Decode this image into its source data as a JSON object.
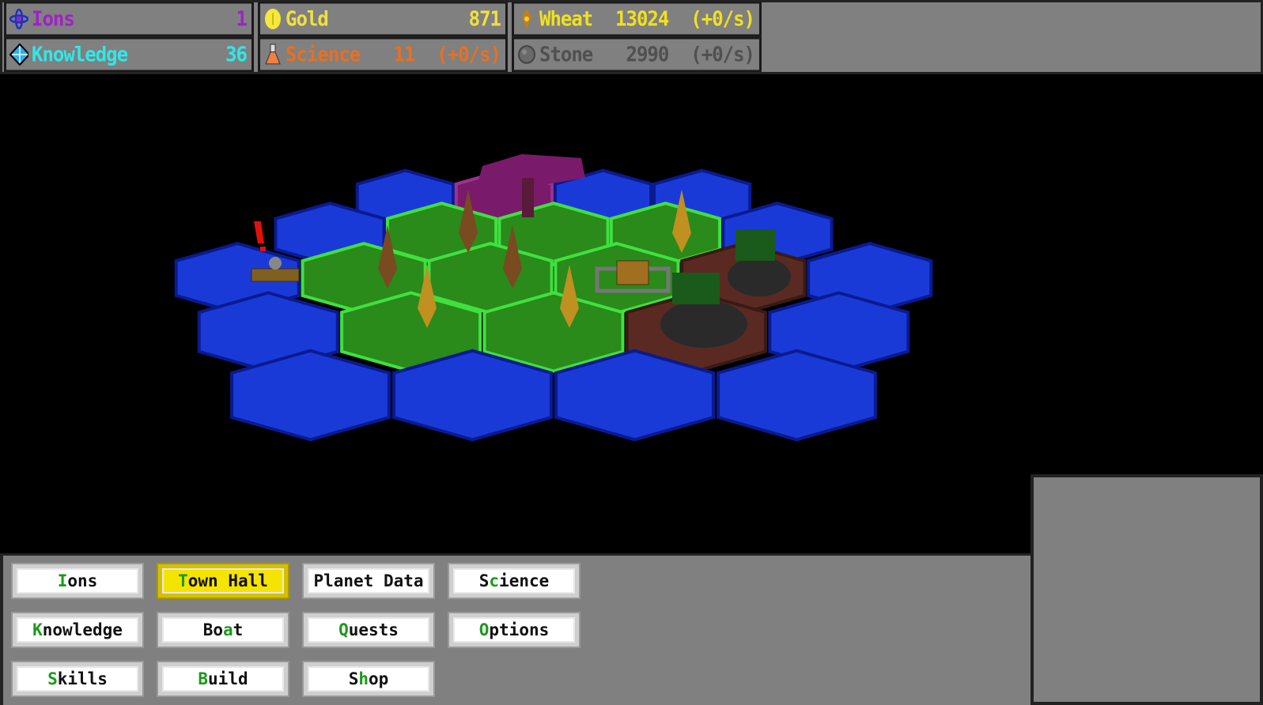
{
  "resources": [
    {
      "id": "ions",
      "icon": "atom-icon",
      "name": "Ions",
      "value": "1",
      "rate": "",
      "color": "#a020c8"
    },
    {
      "id": "gold",
      "icon": "gold-coin-icon",
      "name": "Gold",
      "value": "871",
      "rate": "",
      "color": "#f0e040"
    },
    {
      "id": "wheat",
      "icon": "wheat-icon",
      "name": "Wheat",
      "value": "13024",
      "rate": "(+0/s)",
      "color": "#f0e020"
    },
    {
      "id": "knowledge",
      "icon": "diamond-icon",
      "name": "Knowledge",
      "value": "36",
      "rate": "",
      "color": "#30e8e8"
    },
    {
      "id": "science",
      "icon": "flask-icon",
      "name": "Science",
      "value": "11",
      "rate": "(+0/s)",
      "color": "#e87020"
    },
    {
      "id": "stone",
      "icon": "stone-icon",
      "name": "Stone",
      "value": "2990",
      "rate": "(+0/s)",
      "color": "#505050"
    }
  ],
  "menu": [
    {
      "pre": "",
      "hk": "I",
      "post": "ons",
      "selected": false
    },
    {
      "pre": "",
      "hk": "T",
      "post": "own Hall",
      "selected": true
    },
    {
      "pre": "Planet Data",
      "hk": "",
      "post": "",
      "selected": false
    },
    {
      "pre": "S",
      "hk": "c",
      "post": "ience",
      "selected": false
    },
    {
      "pre": "",
      "hk": "K",
      "post": "nowledge",
      "selected": false
    },
    {
      "pre": "Bo",
      "hk": "a",
      "post": "t",
      "selected": false
    },
    {
      "pre": "",
      "hk": "Q",
      "post": "uests",
      "selected": false
    },
    {
      "pre": "",
      "hk": "O",
      "post": "ptions",
      "selected": false
    },
    {
      "pre": "",
      "hk": "S",
      "post": "kills",
      "selected": false
    },
    {
      "pre": "",
      "hk": "B",
      "post": "uild",
      "selected": false
    },
    {
      "pre": "S",
      "hk": "h",
      "post": "op",
      "selected": false
    }
  ],
  "colors": {
    "water": "#1a3ad8",
    "grass": "#2a8a1a",
    "rock": "#5a2a22",
    "selected": "#7a1a6a",
    "accent": "#f5e400"
  }
}
